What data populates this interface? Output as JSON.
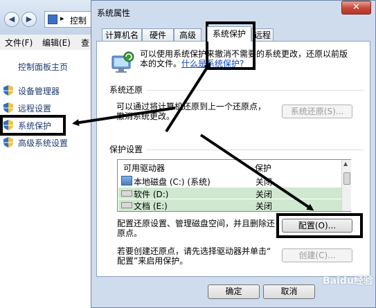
{
  "background_window": {
    "address_fragment": "控制",
    "address_chevron": "▸",
    "menu": [
      "文件(F)",
      "编辑(E)",
      "查"
    ],
    "left_pane": {
      "home": "控制面板主页",
      "links": [
        "设备管理器",
        "远程设置",
        "系统保护",
        "高级系统设置"
      ]
    }
  },
  "dialog": {
    "title": "系统属性",
    "close_glyph": "✕",
    "tabs": [
      "计算机名",
      "硬件",
      "高级",
      "系统保护",
      "远程"
    ],
    "active_tab": "系统保护",
    "intro_text": "可以使用系统保护来撤消不需要的系统更改，还原以前版本的文件。",
    "intro_line1": "可以使用系统保护来撤消不需要的系统更改，还原以前版",
    "intro_line2_prefix": "本的文件。",
    "intro_link": "什么是系统保护?",
    "restore_section": {
      "label": "系统还原",
      "line1": "可以通过将计算机还原到上一个还原点，",
      "line2": "撤消系统更改。",
      "button": "系统还原(S)..."
    },
    "protection_section": {
      "label": "保护设置",
      "columns": [
        "可用驱动器",
        "保护"
      ],
      "drives": [
        {
          "name": "本地磁盘 (C:) (系统)",
          "protection": "关闭"
        },
        {
          "name": "软件 (D:)",
          "protection": "关闭"
        },
        {
          "name": "文档 (E:)",
          "protection": "关闭"
        }
      ],
      "configure_text_line1": "配置还原设置、管理磁盘空间，并且删除还",
      "configure_text_line2": "原点。",
      "configure_button": "配置(O)...",
      "create_text_line1": "若要创建还原点，请先选择驱动器并单击“",
      "create_text_line2": "配置”来启用保护。",
      "create_button": "创建(C)..."
    },
    "footer": {
      "ok": "确定",
      "cancel": "取消",
      "watermark": "Baidu经验"
    }
  },
  "colors": {
    "annotation": "#000000",
    "link": "#0b46b5",
    "drive_highlight": "#cfe8cf"
  }
}
